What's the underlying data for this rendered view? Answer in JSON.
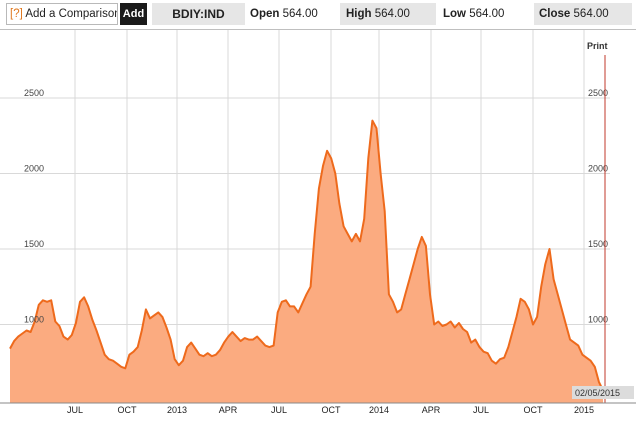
{
  "toolbar": {
    "help_glyph": "[?]",
    "compare_text": "Add a Comparison",
    "add_label": "Add",
    "ticker": "BDIY:IND",
    "open_label": "Open",
    "open_value": "564.00",
    "high_label": "High",
    "high_value": "564.00",
    "low_label": "Low",
    "low_value": "564.00",
    "close_label": "Close",
    "close_value": "564.00"
  },
  "chart": {
    "print_label": "Print",
    "date_badge": "02/05/2015",
    "colors": {
      "area": "#fbab80",
      "line": "#ee6a1c",
      "grid": "#d9d9d9",
      "marker": "#c0392b"
    }
  },
  "chart_data": {
    "type": "area",
    "series": [
      {
        "values": [
          840,
          890,
          920,
          940,
          960,
          950,
          1020,
          1130,
          1160,
          1150,
          1160,
          1020,
          990,
          920,
          900,
          930,
          1010,
          1150,
          1180,
          1120,
          1030,
          960,
          880,
          800,
          770,
          760,
          740,
          720,
          710,
          800,
          820,
          850,
          960,
          1100,
          1040,
          1060,
          1080,
          1050,
          980,
          900,
          770,
          730,
          760,
          850,
          880,
          840,
          800,
          790,
          810,
          790,
          800,
          830,
          880,
          920,
          950,
          920,
          890,
          910,
          900,
          900,
          920,
          890,
          860,
          850,
          860,
          1080,
          1150,
          1160,
          1120,
          1120,
          1080,
          1140,
          1200,
          1250,
          1600,
          1900,
          2050,
          2150,
          2100,
          2000,
          1800,
          1650,
          1600,
          1550,
          1600,
          1550,
          1700,
          2100,
          2350,
          2300,
          2000,
          1750,
          1200,
          1150,
          1080,
          1100,
          1200,
          1300,
          1400,
          1500,
          1580,
          1520,
          1200,
          1000,
          1020,
          990,
          1000,
          1020,
          980,
          1010,
          970,
          950,
          880,
          900,
          850,
          820,
          810,
          760,
          740,
          770,
          780,
          850,
          950,
          1050,
          1170,
          1150,
          1100,
          1000,
          1050,
          1250,
          1400,
          1500,
          1300,
          1200,
          1100,
          1000,
          900,
          880,
          860,
          800,
          780,
          760,
          720,
          620,
          564
        ]
      }
    ],
    "y_ticks": [
      "1000",
      "1500",
      "2000",
      "2500"
    ],
    "x_ticks": [
      "JUL",
      "OCT",
      "2013",
      "APR",
      "JUL",
      "OCT",
      "2014",
      "APR",
      "JUL",
      "OCT",
      "2015"
    ],
    "ylim": [
      480,
      2950
    ],
    "grid": true
  }
}
